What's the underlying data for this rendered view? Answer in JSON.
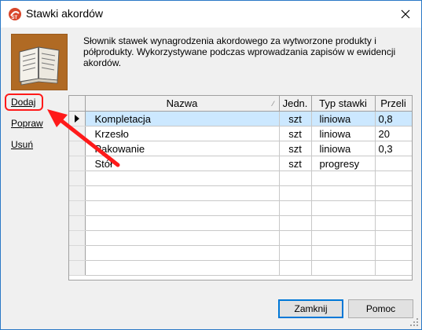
{
  "window": {
    "title": "Stawki akordów",
    "close_icon": "close-icon"
  },
  "header": {
    "icon": "book-icon",
    "description": "Słownik stawek wynagrodzenia akordowego za wytworzone produkty i półprodukty. Wykorzystywane podczas wprowadzania zapisów w ewidencji akordów."
  },
  "actions": {
    "add": "Dodaj",
    "edit": "Popraw",
    "delete": "Usuń"
  },
  "table": {
    "columns": [
      "Nazwa",
      "Jedn.",
      "Typ stawki",
      "Przeli"
    ],
    "rows": [
      {
        "nazwa": "Kompletacja",
        "jedn": "szt",
        "typ": "liniowa",
        "przeli": "0,8",
        "selected": true
      },
      {
        "nazwa": "Krzesło",
        "jedn": "szt",
        "typ": "liniowa",
        "przeli": "20",
        "selected": false
      },
      {
        "nazwa": "Pakowanie",
        "jedn": "szt",
        "typ": "liniowa",
        "przeli": "0,3",
        "selected": false
      },
      {
        "nazwa": "Stół",
        "jedn": "szt",
        "typ": "progresy",
        "przeli": "",
        "selected": false
      }
    ],
    "empty_rows": 7,
    "selected_indicator": "row-pointer-icon"
  },
  "footer": {
    "close": "Zamknij",
    "help": "Pomoc"
  },
  "annotation": {
    "color": "#ff1a1a",
    "target": "Dodaj"
  },
  "colors": {
    "selection": "#cce8ff",
    "window_border": "#2a79c6",
    "icon_bg": "#b06a24"
  }
}
